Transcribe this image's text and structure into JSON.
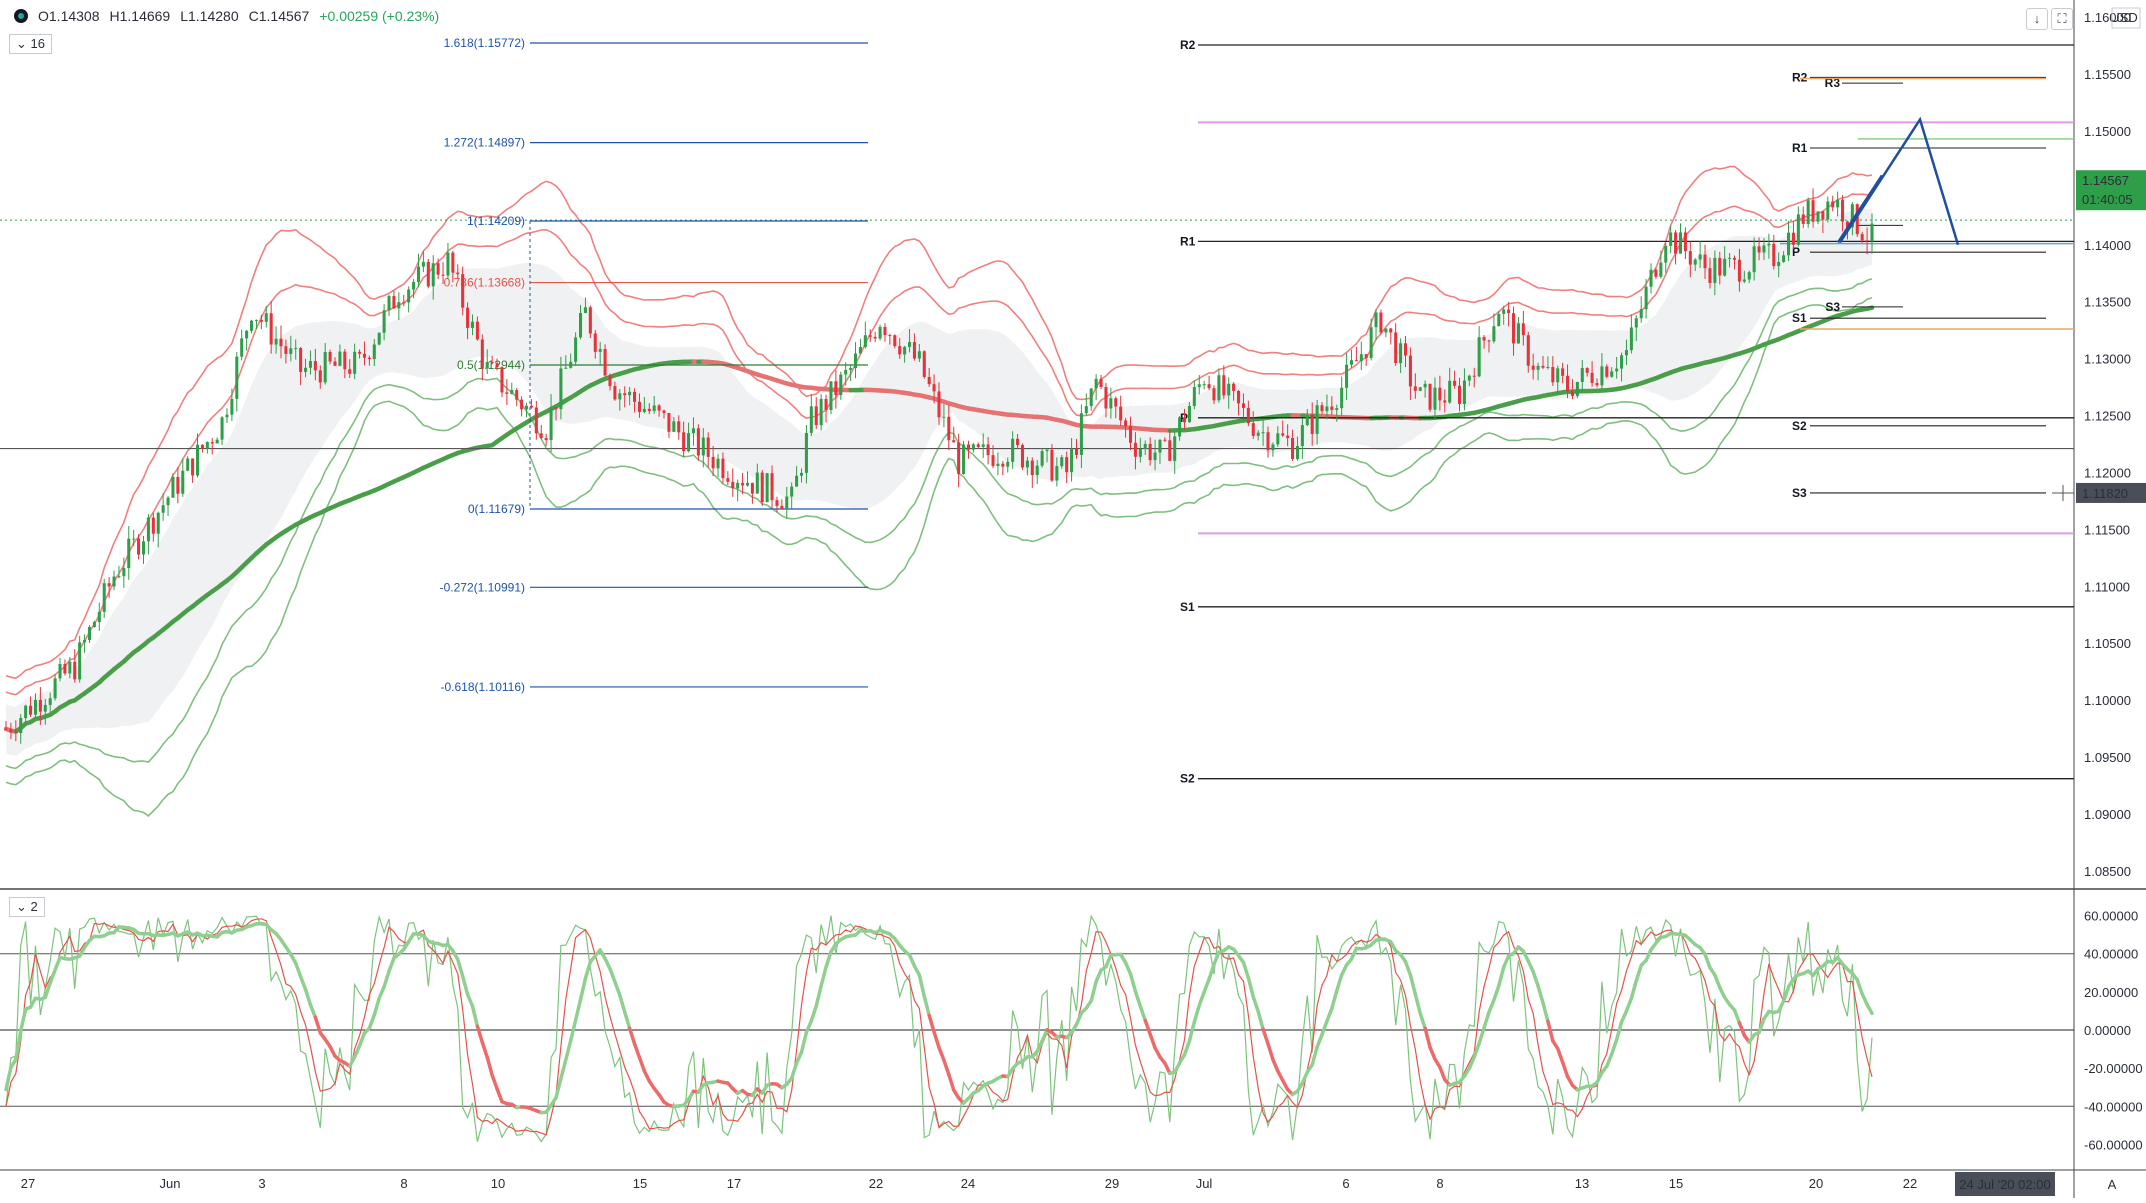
{
  "header": {
    "open": "O1.14308",
    "high": "H1.14669",
    "low": "L1.14280",
    "close": "C1.14567",
    "change": "+0.00259 (+0.23%)"
  },
  "main_indicator_label": "16",
  "osc_indicator_label": "2",
  "currency": "USD",
  "last_price": "1.14567",
  "countdown": "01:40:05",
  "crosshair_price": "1.11820",
  "crosshair_time": "24 Jul '20  02:00",
  "auto_label": "A",
  "price_axis": [
    "1.16000",
    "1.15500",
    "1.15000",
    "1.14500",
    "1.14000",
    "1.13500",
    "1.13000",
    "1.12500",
    "1.12000",
    "1.11500",
    "1.11000",
    "1.10500",
    "1.10000",
    "1.09500",
    "1.09000",
    "1.08500"
  ],
  "osc_axis": [
    "60.00000",
    "40.00000",
    "20.00000",
    "0.00000",
    "-20.00000",
    "-40.00000",
    "-60.00000"
  ],
  "time_axis": [
    "27",
    "Jun",
    "3",
    "8",
    "10",
    "15",
    "17",
    "22",
    "24",
    "29",
    "Jul",
    "6",
    "8",
    "13",
    "15",
    "20",
    "22"
  ],
  "fib_levels": [
    {
      "label": "1.618(1.15772)",
      "price": 1.15772,
      "color": "#1e53a8"
    },
    {
      "label": "1.272(1.14897)",
      "price": 1.14897,
      "color": "#1e53a8"
    },
    {
      "label": "1(1.14209)",
      "price": 1.14209,
      "color": "#1e53a8"
    },
    {
      "label": "0.786(1.13668)",
      "price": 1.13668,
      "color": "#e5534b"
    },
    {
      "label": "0.5(1.12944)",
      "price": 1.12944,
      "color": "#2e7d32"
    },
    {
      "label": "0(1.11679)",
      "price": 1.11679,
      "color": "#1e53a8"
    },
    {
      "label": "-0.272(1.10991)",
      "price": 1.10991,
      "color": "#1e53a8"
    },
    {
      "label": "-0.618(1.10116)",
      "price": 1.10116,
      "color": "#1e53a8"
    }
  ],
  "monthly_pivots": [
    {
      "label": "R2",
      "price": 1.15755
    },
    {
      "label": "R1",
      "price": 1.1403
    },
    {
      "label": "P",
      "price": 1.1248
    },
    {
      "label": "S1",
      "price": 1.1082
    },
    {
      "label": "S2",
      "price": 1.0931
    }
  ],
  "weekly_pivots": [
    {
      "label": "R2",
      "price": 1.1547
    },
    {
      "label": "R1",
      "price": 1.1485
    },
    {
      "label": "P",
      "price": 1.13935
    },
    {
      "label": "S1",
      "price": 1.13355
    },
    {
      "label": "S2",
      "price": 1.1241
    },
    {
      "label": "S3",
      "price": 1.1182
    }
  ],
  "daily_pivots": [
    {
      "label": "R3",
      "price": 1.1542
    },
    {
      "label": "S3",
      "price": 1.13455
    }
  ],
  "colors": {
    "bull": "#2e9e48",
    "bear": "#e5323b",
    "band_red": "#f08080",
    "band_green": "#7fbf7f",
    "ma_green": "#4a9e4a",
    "ma_red": "#e57373",
    "magenta": "#e09be8",
    "orange": "#f0a860",
    "pattern": "#1e4fa0",
    "last_price_bg": "#2e9e48"
  },
  "chart_data": {
    "type": "candlestick",
    "symbol_interval": "4h",
    "ylim": [
      1.0835,
      1.1615
    ],
    "seed": 7,
    "path": [
      [
        0,
        1.0975
      ],
      [
        14,
        1.103
      ],
      [
        22,
        1.111
      ],
      [
        34,
        1.1185
      ],
      [
        44,
        1.1245
      ],
      [
        50,
        1.1345
      ],
      [
        60,
        1.129
      ],
      [
        72,
        1.1295
      ],
      [
        80,
        1.136
      ],
      [
        90,
        1.1385
      ],
      [
        98,
        1.129
      ],
      [
        110,
        1.124
      ],
      [
        118,
        1.134
      ],
      [
        124,
        1.1275
      ],
      [
        134,
        1.1245
      ],
      [
        148,
        1.12
      ],
      [
        160,
        1.1175
      ],
      [
        164,
        1.1245
      ],
      [
        172,
        1.129
      ],
      [
        178,
        1.1335
      ],
      [
        186,
        1.1295
      ],
      [
        194,
        1.121
      ],
      [
        204,
        1.122
      ],
      [
        216,
        1.12
      ],
      [
        222,
        1.128
      ],
      [
        230,
        1.1225
      ],
      [
        236,
        1.1215
      ],
      [
        244,
        1.1285
      ],
      [
        256,
        1.1235
      ],
      [
        262,
        1.1225
      ],
      [
        272,
        1.1275
      ],
      [
        280,
        1.1335
      ],
      [
        288,
        1.1265
      ],
      [
        296,
        1.127
      ],
      [
        304,
        1.1345
      ],
      [
        312,
        1.129
      ],
      [
        318,
        1.1275
      ],
      [
        330,
        1.1305
      ],
      [
        338,
        1.141
      ],
      [
        346,
        1.138
      ],
      [
        352,
        1.138
      ],
      [
        360,
        1.139
      ],
      [
        366,
        1.1425
      ],
      [
        372,
        1.144
      ],
      [
        380,
        1.1405
      ]
    ],
    "oscillator_range": [
      -65,
      65
    ]
  }
}
